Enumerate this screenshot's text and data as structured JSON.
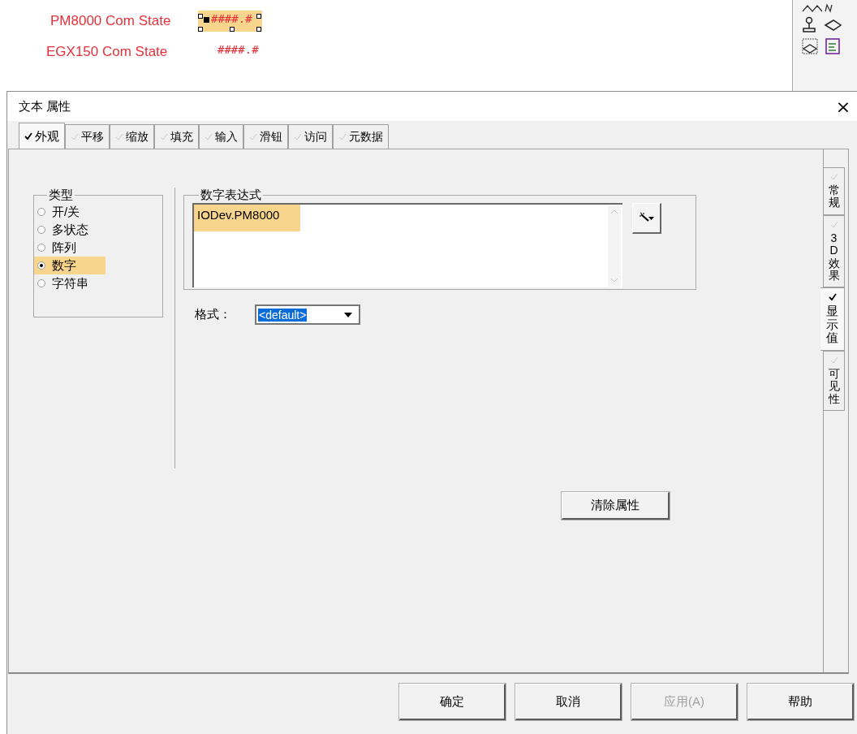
{
  "canvas": {
    "rows": [
      {
        "label": "PM8000 Com State",
        "value": "####.#",
        "selected": true
      },
      {
        "label": "EGX150 Com State",
        "value": "####.#",
        "selected": false
      }
    ]
  },
  "dialog": {
    "title": "文本 属性",
    "close": "×",
    "tabs": [
      {
        "label": "外观",
        "selected": true
      },
      {
        "label": "平移",
        "selected": false
      },
      {
        "label": "缩放",
        "selected": false
      },
      {
        "label": "填充",
        "selected": false
      },
      {
        "label": "输入",
        "selected": false
      },
      {
        "label": "滑钮",
        "selected": false
      },
      {
        "label": "访问",
        "selected": false
      },
      {
        "label": "元数据",
        "selected": false
      }
    ],
    "type_group": {
      "title": "类型",
      "options": [
        {
          "label": "开/关",
          "selected": false
        },
        {
          "label": "多状态",
          "selected": false
        },
        {
          "label": "阵列",
          "selected": false
        },
        {
          "label": "数字",
          "selected": true
        },
        {
          "label": "字符串",
          "selected": false
        }
      ]
    },
    "expression_group": {
      "title": "数字表达式",
      "value": "IODev.PM8000"
    },
    "format": {
      "label": "格式：",
      "value": "<default>"
    },
    "clear_button": "清除属性",
    "side_tabs": [
      {
        "label": "常规",
        "selected": false
      },
      {
        "label": "3D效果",
        "selected": false
      },
      {
        "label": "显示值",
        "selected": true
      },
      {
        "label": "可见性",
        "selected": false
      }
    ],
    "buttons": [
      {
        "label": "确定",
        "disabled": false
      },
      {
        "label": "取消",
        "disabled": false
      },
      {
        "label": "应用(A)",
        "disabled": true
      },
      {
        "label": "帮助",
        "disabled": false
      }
    ]
  }
}
